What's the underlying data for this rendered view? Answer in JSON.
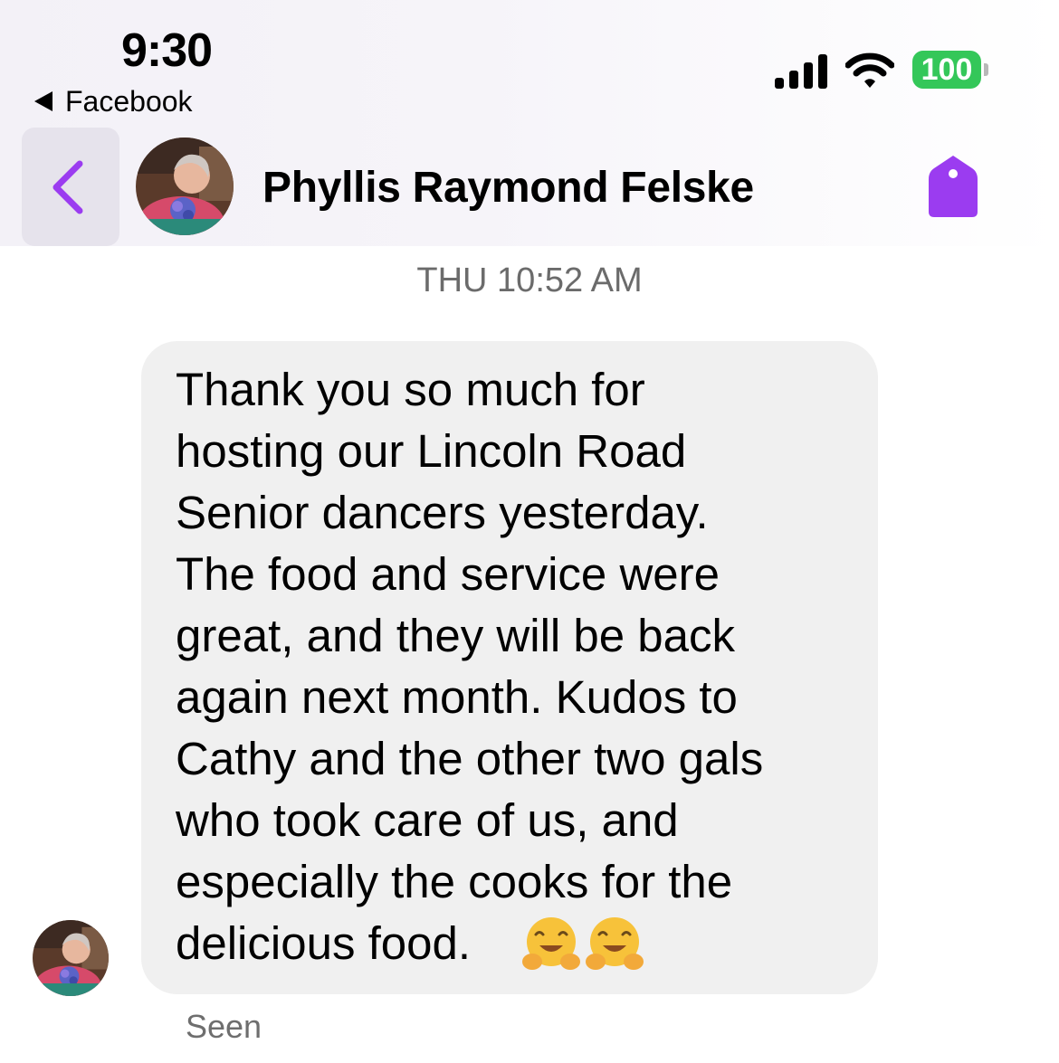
{
  "status_bar": {
    "time": "9:30",
    "back_app_label": "Facebook",
    "battery": "100",
    "battery_color": "#34c759"
  },
  "header": {
    "contact_name": "Phyllis Raymond Felske",
    "back_icon": "chevron-left-icon",
    "tag_icon": "tag-icon",
    "accent_color": "#9b3cf0"
  },
  "conversation": {
    "timestamp": "THU 10:52 AM",
    "message": {
      "text": "Thank you so much for\nhosting our Lincoln Road\nSenior dancers yesterday.\nThe food and service were\ngreat, and they will be back\nagain next month.  Kudos to\nCathy and the other two gals\nwho took care of us, and\nespecially the cooks for the\ndelicious food.",
      "emojis": [
        "hugging-face-emoji",
        "hugging-face-emoji"
      ]
    },
    "read_receipt": "Seen"
  }
}
